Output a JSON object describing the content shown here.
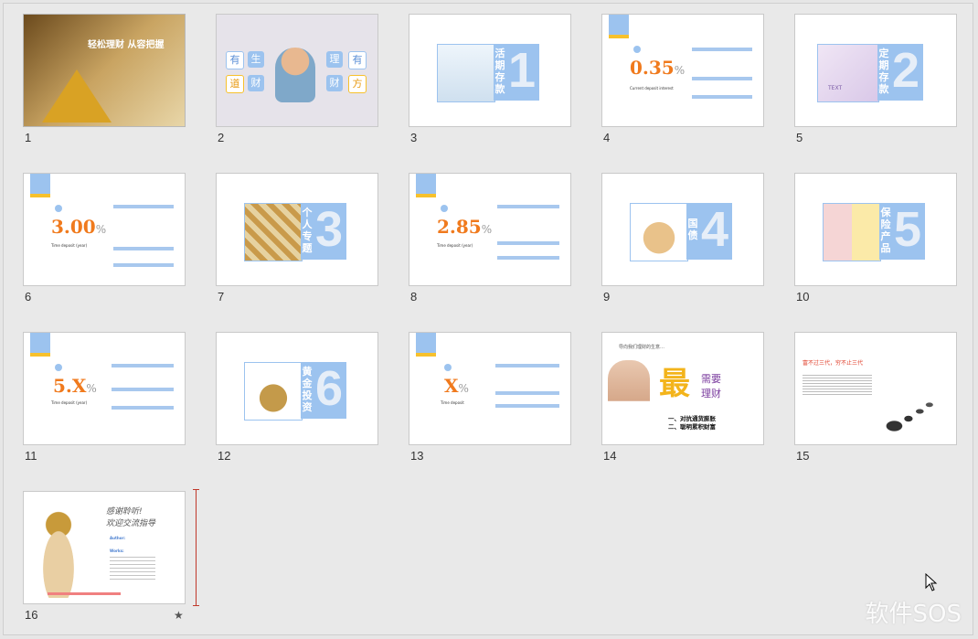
{
  "slides": [
    {
      "n": "1",
      "title": "轻松理财 从容把握"
    },
    {
      "n": "2",
      "chars": [
        "有",
        "生",
        "道",
        "财",
        "理",
        "有",
        "财",
        "方"
      ]
    },
    {
      "n": "3",
      "label": "活期存款",
      "digit": "1"
    },
    {
      "n": "4",
      "rate": "0.35",
      "pct": "%",
      "sub": "Current deposit interest"
    },
    {
      "n": "5",
      "label": "定期存款",
      "digit": "2",
      "pic_text": "TEXT"
    },
    {
      "n": "6",
      "rate": "3.00",
      "pct": "%",
      "sub": "Time deposit (year)"
    },
    {
      "n": "7",
      "label": "个人专题",
      "digit": "3"
    },
    {
      "n": "8",
      "rate": "2.85",
      "pct": "%",
      "sub": "Time deposit (year)"
    },
    {
      "n": "9",
      "label": "国债",
      "digit": "4"
    },
    {
      "n": "10",
      "label": "保险产品",
      "digit": "5"
    },
    {
      "n": "11",
      "rate": "5.X",
      "pct": "%",
      "sub": "Time deposit (year)"
    },
    {
      "n": "12",
      "label": "黄金投资",
      "digit": "6"
    },
    {
      "n": "13",
      "rate": "X",
      "pct": "%",
      "sub": "Time deposit"
    },
    {
      "n": "14",
      "header": "导向我们理财的生意…",
      "big": "最",
      "need": "需要",
      "lc": "理财",
      "l1": "一、对抗通货膨胀",
      "l2": "二、聪明累积财富"
    },
    {
      "n": "15",
      "heading": "富不过三代，穷不止三代"
    },
    {
      "n": "16",
      "hand1": "感谢聆听!",
      "hand2": "欢迎交流指导",
      "author": "Author:",
      "works": "Works:"
    }
  ],
  "star": "★",
  "watermark": "软件SOS"
}
